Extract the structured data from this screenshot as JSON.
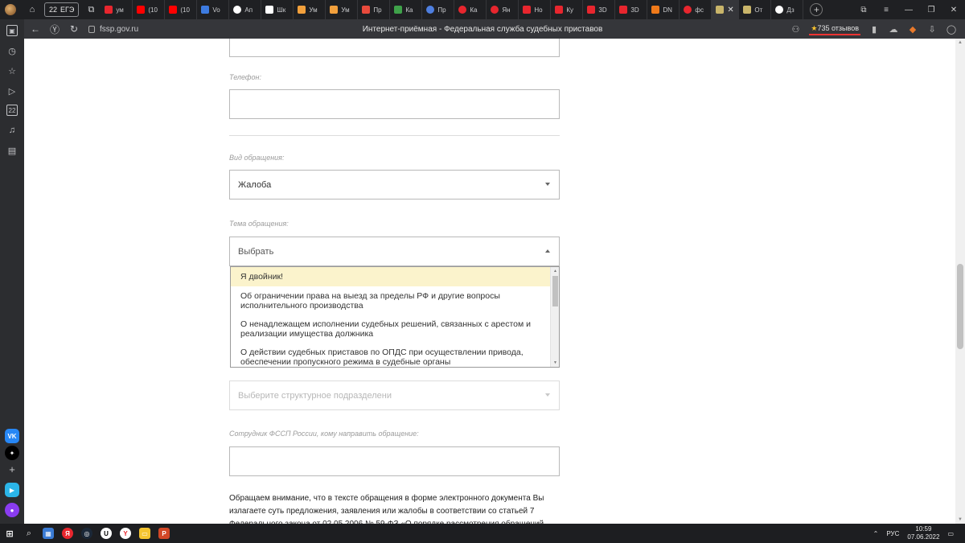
{
  "browser": {
    "tab_group_count": "22",
    "tab_group_label": "ЕГЭ",
    "tabs": [
      "ум",
      "(10",
      "(10",
      "Vo",
      "Ап",
      "Шк",
      "Ум",
      "Ум",
      "Пр",
      "Ка",
      "Пр",
      "Ка",
      "Ян",
      "Но",
      "Ку",
      "3D",
      "3D",
      "DN",
      "фс",
      "",
      "От",
      "Дз"
    ],
    "url": "fssp.gov.ru",
    "page_title": "Интернет-приёмная - Федеральная служба судебных приставов",
    "reviews": "735 отзывов",
    "sidebar_badge": "22"
  },
  "form": {
    "phone_label": "Телефон:",
    "appeal_type_label": "Вид обращения:",
    "appeal_type_value": "Жалоба",
    "topic_label": "Тема обращения:",
    "topic_placeholder": "Выбрать",
    "topic_options": [
      "Я двойник!",
      "Об ограничении права на выезд за пределы РФ и другие вопросы исполнительного производства",
      "О ненадлежащем исполнении судебных решений, связанных с арестом и реализации имущества должника",
      "О действии судебных приставов по ОПДС при осуществлении привода, обеспечении пропускного режима в судебные органы"
    ],
    "division_placeholder": "Выберите структурное подразделени",
    "employee_label": "Сотрудник ФССП России, кому направить обращение:",
    "notice": "Обращаем внимание, что в тексте обращения в форме электронного документа Вы излагаете суть предложения, заявления или жалобы в соответствии со статьей 7 Федерального закона от 02.05.2006 № 59-ФЗ «О порядке рассмотрения обращений"
  },
  "taskbar": {
    "lang": "РУС",
    "time": "10:59",
    "date": "07.06.2022"
  },
  "colors": {
    "highlight": "#fbf3cc",
    "chrome_dark": "#1f2023",
    "address_bar": "#35363a"
  }
}
